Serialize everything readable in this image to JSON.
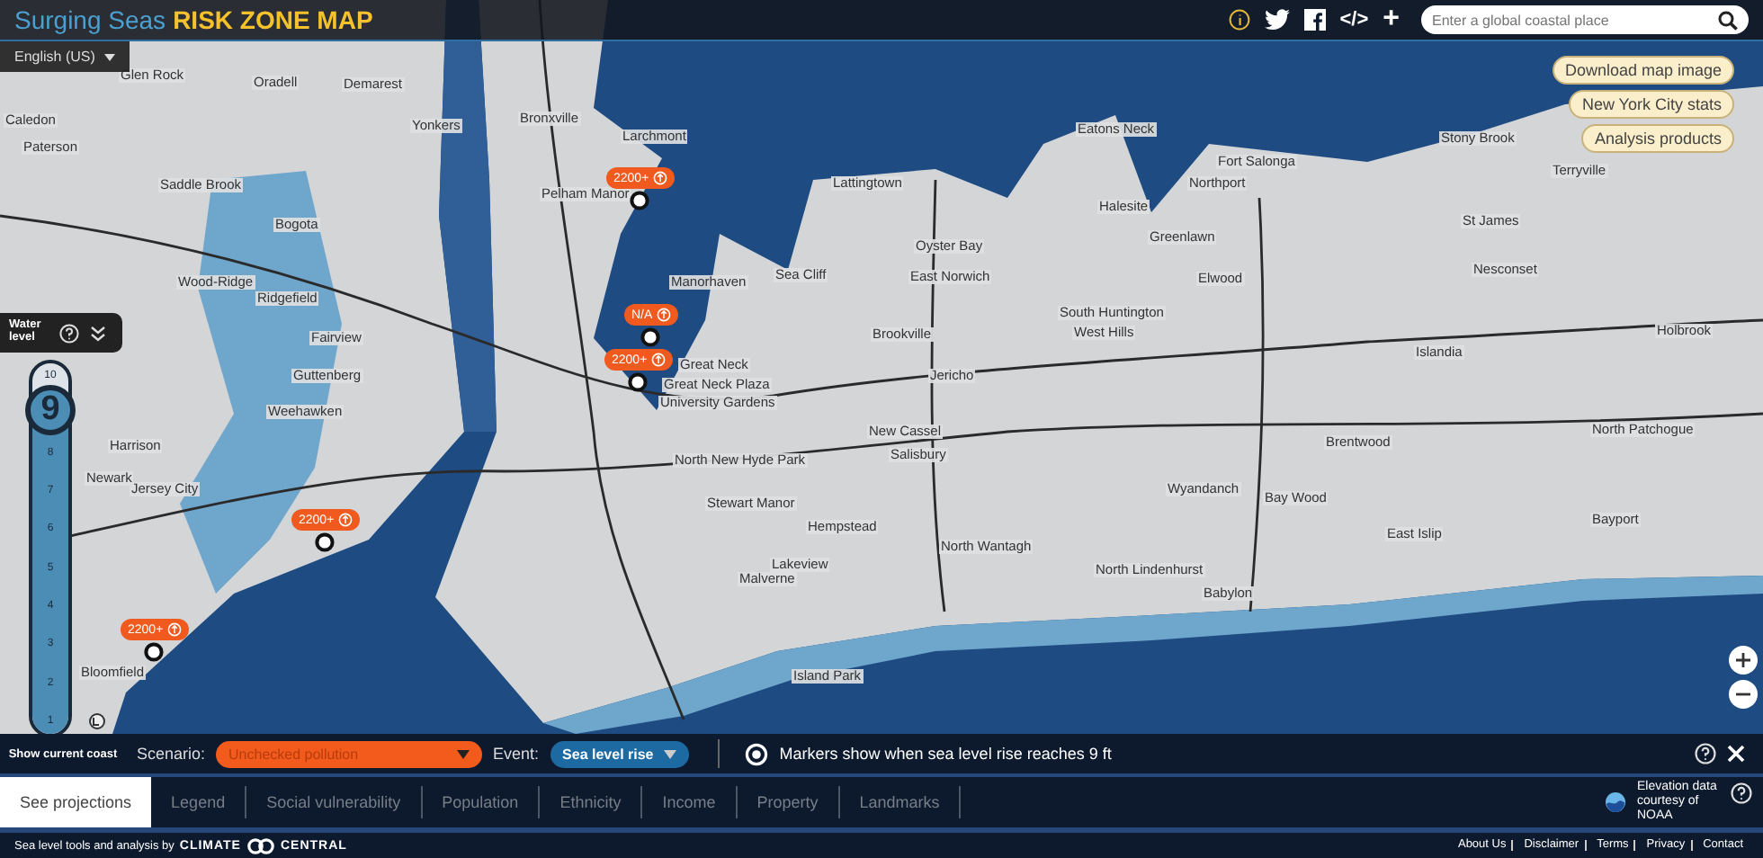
{
  "header": {
    "title": "Surging Seas",
    "subtitle": "RISK ZONE MAP",
    "embed_icon": "</>",
    "add_icon": "+",
    "search": {
      "placeholder": "Enter a global coastal place"
    }
  },
  "language": "English (US)",
  "map_actions": [
    "Download map image",
    "New York City stats",
    "Analysis products"
  ],
  "places": [
    "Glen Rock",
    "Oradell",
    "Demarest",
    "Yonkers",
    "Bronxville",
    "Larchmont",
    "Paterson",
    "Saddle Brook",
    "Pelham Manor",
    "Lattingtown",
    "Eatons Neck",
    "Fort Salonga",
    "Northport",
    "Stony Brook",
    "Terryville",
    "Halesite",
    "Greenlawn",
    "Oyster Bay",
    "Bogota",
    "Wood-Ridge",
    "Ridgefield",
    "Manorhaven",
    "Sea Cliff",
    "East Norwich",
    "Elwood",
    "St James",
    "Nesconset",
    "Fairview",
    "Guttenberg",
    "Weehawken",
    "Great Neck",
    "Great Neck Plaza",
    "University Gardens",
    "Brookville",
    "South Huntington",
    "West Hills",
    "Jericho",
    "Islandia",
    "Brentwood",
    "Harrison",
    "Newark",
    "Jersey City",
    "New Cassel",
    "Salisbury",
    "North New Hyde Park",
    "Wyandanch",
    "Bay Wood",
    "North Patchogue",
    "Stewart Manor",
    "Hempstead",
    "North Wantagh",
    "North Lindenhurst",
    "East Islip",
    "Bayport",
    "Babylon",
    "Lakeview",
    "Malverne",
    "Island Park",
    "Bloomfield",
    "Caledon",
    "Holbrook"
  ],
  "markers": [
    {
      "label": "2200+"
    },
    {
      "label": "N/A"
    },
    {
      "label": "2200+"
    },
    {
      "label": "2200+"
    },
    {
      "label": "2200+"
    }
  ],
  "water_level": {
    "title": "Water level",
    "value": "9",
    "level": 0.9,
    "ticks": [
      "10",
      "8",
      "7",
      "6",
      "5",
      "4",
      "3",
      "2",
      "1"
    ]
  },
  "show_current_coast": "Show current coast",
  "scenario": {
    "label": "Scenario:",
    "value": "Unchecked pollution"
  },
  "event": {
    "label": "Event:",
    "value": "Sea level rise"
  },
  "marker_note": "Markers show when sea level rise reaches 9 ft",
  "tabs": [
    {
      "label": "See projections",
      "selected": true
    },
    {
      "label": "Legend",
      "selected": false
    },
    {
      "label": "Social vulnerability",
      "selected": false
    },
    {
      "label": "Population",
      "selected": false
    },
    {
      "label": "Ethnicity",
      "selected": false
    },
    {
      "label": "Income",
      "selected": false
    },
    {
      "label": "Property",
      "selected": false
    },
    {
      "label": "Landmarks",
      "selected": false
    }
  ],
  "credit": "Elevation data courtesy of NOAA",
  "footer": {
    "text": "Sea level tools and analysis by",
    "brand": [
      "CLIMATE",
      "CENTRAL"
    ],
    "links": [
      "About Us",
      "Disclaimer",
      "Terms",
      "Privacy",
      "Contact"
    ]
  }
}
